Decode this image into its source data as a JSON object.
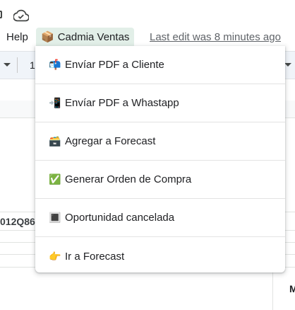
{
  "menubar": {
    "help_label": "Help",
    "addon_icon": "📦",
    "addon_label": "Cadmia Ventas",
    "last_edit": "Last edit was 8 minutes ago"
  },
  "toolbar": {
    "font_size": "1"
  },
  "sheet": {
    "visible_cell_code": "012Q86",
    "visible_cell_m": "M"
  },
  "dropdown": {
    "items": [
      {
        "icon": "📬",
        "label": "Envíar PDF a Cliente"
      },
      {
        "icon": "📲",
        "label": "Envíar PDF a Whastapp"
      },
      {
        "icon": "🗃️",
        "label": "Agregar a Forecast"
      },
      {
        "icon": "✅",
        "label": "Generar Orden de Compra"
      },
      {
        "icon": "🔳",
        "label": "Oportunidad cancelada"
      },
      {
        "icon": "👉",
        "label": "Ir a Forecast"
      }
    ]
  }
}
